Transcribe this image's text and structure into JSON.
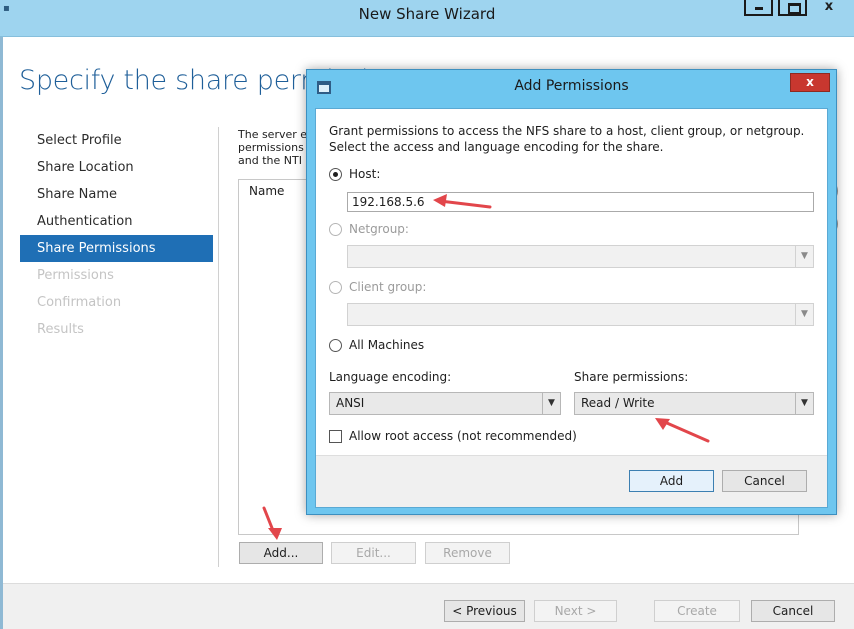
{
  "wizard": {
    "title": "New Share Wizard",
    "heading": "Specify the share permissi",
    "steps": [
      {
        "label": "Select Profile",
        "state": "normal"
      },
      {
        "label": "Share Location",
        "state": "normal"
      },
      {
        "label": "Share Name",
        "state": "normal"
      },
      {
        "label": "Authentication",
        "state": "normal"
      },
      {
        "label": "Share Permissions",
        "state": "active"
      },
      {
        "label": "Permissions",
        "state": "disabled"
      },
      {
        "label": "Confirmation",
        "state": "disabled"
      },
      {
        "label": "Results",
        "state": "disabled"
      }
    ],
    "description_lines": [
      "The server e",
      "permissions",
      "and the NTI"
    ],
    "list_column": "Name",
    "list_buttons": {
      "add": "Add...",
      "edit": "Edit...",
      "remove": "Remove"
    },
    "nav_buttons": {
      "previous": "< Previous",
      "next": "Next >",
      "create": "Create",
      "cancel": "Cancel"
    }
  },
  "dialog": {
    "title": "Add Permissions",
    "close_label": "x",
    "intro": "Grant permissions to access the NFS share to a host, client group, or netgroup. Select the access and language encoding for the share.",
    "host_label": "Host:",
    "host_value": "192.168.5.6",
    "netgroup_label": "Netgroup:",
    "client_group_label": "Client group:",
    "all_machines_label": "All Machines",
    "language_label": "Language encoding:",
    "language_value": "ANSI",
    "share_perm_label": "Share permissions:",
    "share_perm_value": "Read / Write",
    "root_access_label": "Allow root access (not recommended)",
    "add_button": "Add",
    "cancel_button": "Cancel"
  },
  "accent_colors": {
    "titlebar": "#9ed4ef",
    "dialog_frame": "#6ec6ef",
    "selected_step": "#1f6fb5",
    "heading": "#1f5f99",
    "arrow": "#e2464b",
    "close_button": "#c8372f"
  }
}
